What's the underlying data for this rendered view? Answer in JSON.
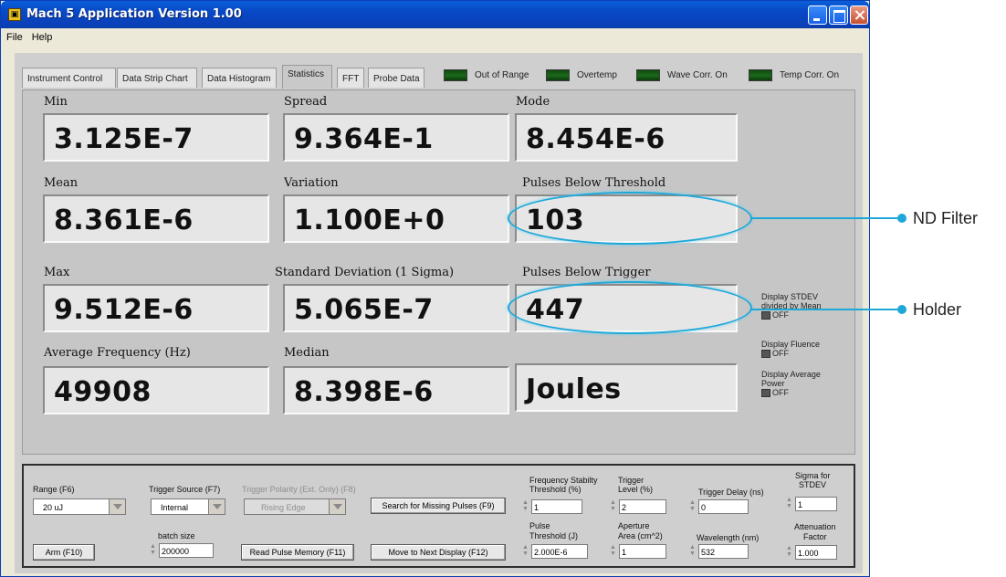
{
  "window": {
    "title": "Mach 5 Application Version 1.00"
  },
  "menu": [
    "File",
    "Help"
  ],
  "tabs": [
    "Instrument Control",
    "Data Strip Chart",
    "Data Histogram",
    "Statistics",
    "FFT",
    "Probe Data"
  ],
  "active_tab": "Statistics",
  "indicators": [
    "Out of Range",
    "Overtemp",
    "Wave Corr. On",
    "Temp Corr. On"
  ],
  "stats": {
    "min": {
      "label": "Min",
      "value": "3.125E-7"
    },
    "spread": {
      "label": "Spread",
      "value": "9.364E-1"
    },
    "mode": {
      "label": "Mode",
      "value": "8.454E-6"
    },
    "mean": {
      "label": "Mean",
      "value": "8.361E-6"
    },
    "variation": {
      "label": "Variation",
      "value": "1.100E+0"
    },
    "pulses_below_threshold": {
      "label": "Pulses Below Threshold",
      "value": "103"
    },
    "max": {
      "label": "Max",
      "value": "9.512E-6"
    },
    "std_dev": {
      "label": "Standard Deviation (1 Sigma)",
      "value": "5.065E-7"
    },
    "pulses_below_trigger": {
      "label": "Pulses Below Trigger",
      "value": "447"
    },
    "avg_freq": {
      "label": "Average Frequency (Hz)",
      "value": "49908"
    },
    "median": {
      "label": "Median",
      "value": "8.398E-6"
    },
    "units": {
      "value": "Joules"
    }
  },
  "side_toggles": [
    {
      "label": "Display STDEV divided by Mean",
      "state": "OFF"
    },
    {
      "label": "Display Fluence",
      "state": "OFF"
    },
    {
      "label": "Display Average Power",
      "state": "OFF"
    }
  ],
  "callouts": {
    "nd_filter": "ND Filter",
    "holder": "Holder"
  },
  "controls": {
    "range": {
      "label": "Range (F6)",
      "value": "20 uJ"
    },
    "trigger_source": {
      "label": "Trigger Source (F7)",
      "value": "Internal"
    },
    "trigger_polarity": {
      "label": "Trigger Polarity (Ext. Only) (F8)",
      "value": "Rising Edge"
    },
    "search_button": "Search for Missing Pulses (F9)",
    "freq_stability": {
      "label1": "Frequency Stabilty",
      "label2": "Threshold (%)",
      "value": "1"
    },
    "trigger_level": {
      "label1": "Trigger",
      "label2": "Level (%)",
      "value": "2"
    },
    "trigger_delay": {
      "label": "Trigger Delay (ns)",
      "value": "0"
    },
    "sigma": {
      "label1": "Sigma for",
      "label2": "STDEV",
      "value": "1"
    },
    "arm_button": "Arm (F10)",
    "batch": {
      "label": "batch size",
      "value": "200000"
    },
    "read_button": "Read Pulse Memory (F11)",
    "next_button": "Move to Next Display (F12)",
    "pulse_threshold": {
      "label1": "Pulse",
      "label2": "Threshold (J)",
      "value": "2.000E-6"
    },
    "aperture": {
      "label1": "Aperture",
      "label2": "Area (cm^2)",
      "value": "1"
    },
    "wavelength": {
      "label": "Wavelength (nm)",
      "value": "532"
    },
    "attenuation": {
      "label1": "Attenuation",
      "label2": "Factor",
      "value": "1.000"
    }
  },
  "colors": {
    "accent": "#1ea8d8",
    "titlebar": "#0a5ed8",
    "led_on": "#1b6a1b"
  }
}
